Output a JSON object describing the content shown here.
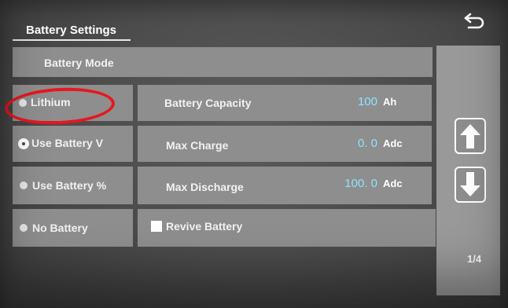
{
  "header": {
    "title": "Battery Settings"
  },
  "battery_mode": {
    "title": "Battery Mode",
    "options": [
      {
        "label": "Lithium",
        "selected": false
      },
      {
        "label": "Use Battery V",
        "selected": true
      },
      {
        "label": "Use Battery %",
        "selected": false
      },
      {
        "label": "No Battery",
        "selected": false
      }
    ]
  },
  "settings": {
    "capacity": {
      "label": "Battery Capacity",
      "value": "100",
      "unit": "Ah"
    },
    "max_charge": {
      "label": "Max Charge",
      "value": "0. 0",
      "unit": "Adc"
    },
    "max_discharge": {
      "label": "Max Discharge",
      "value": "100. 0",
      "unit": "Adc"
    },
    "revive": {
      "label": "Revive Battery",
      "checked": false
    }
  },
  "pagination": {
    "page": "1/4"
  },
  "icons": {
    "back": "back-arrow-icon",
    "up": "arrow-up-icon",
    "down": "arrow-down-icon"
  },
  "colors": {
    "value_text": "#8fe3ff",
    "highlight": "#e8161f"
  }
}
